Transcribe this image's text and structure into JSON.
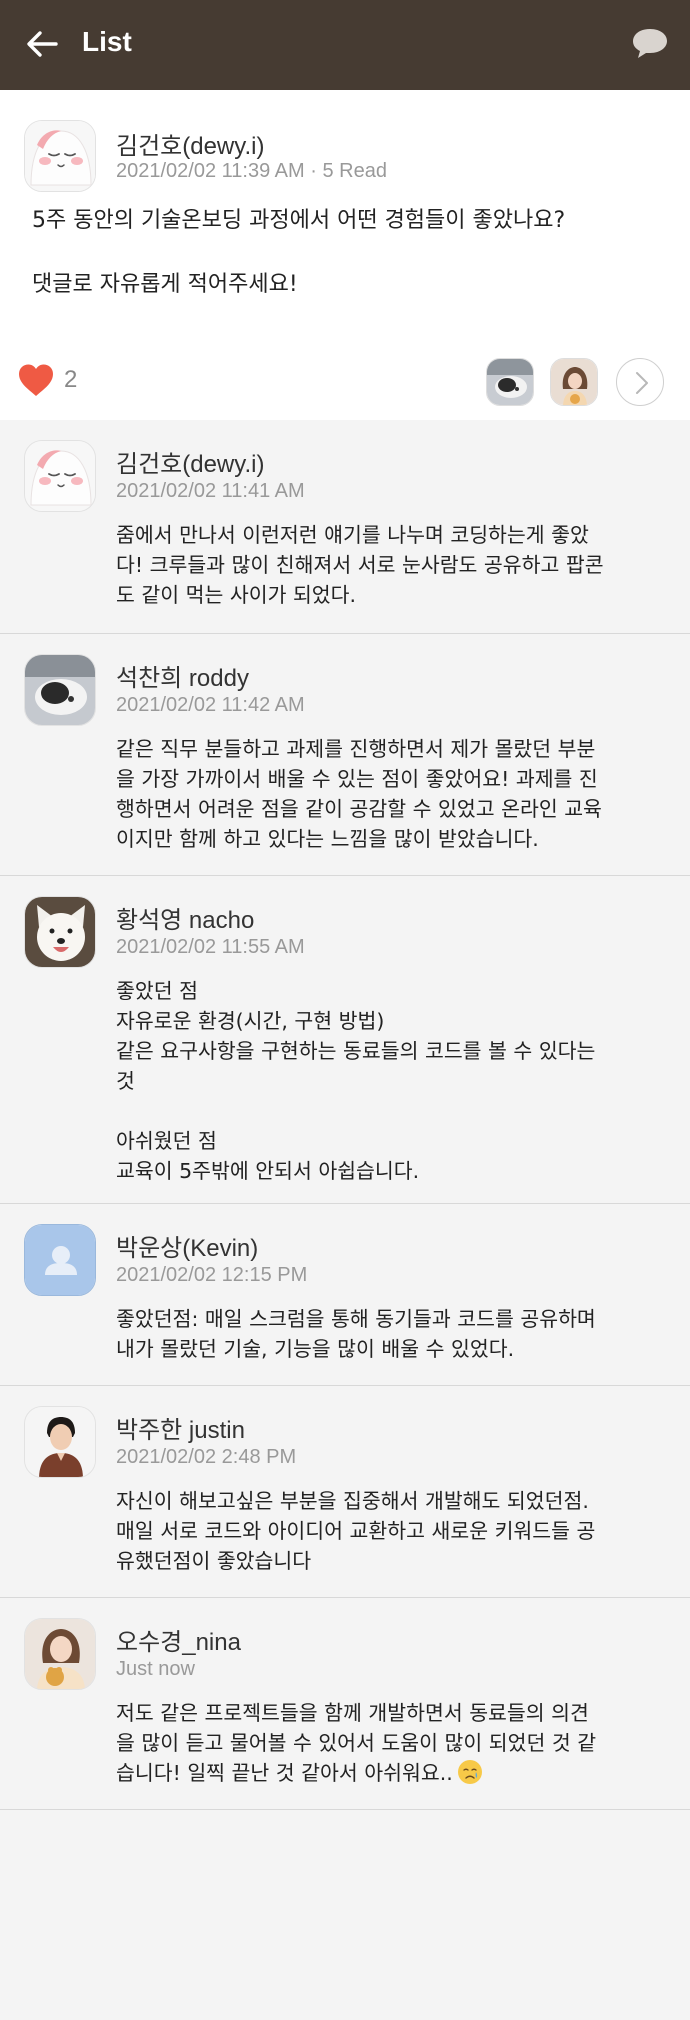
{
  "header": {
    "title": "List",
    "back_icon": "arrow-left-icon",
    "chat_icon": "chat-bubble-icon"
  },
  "post": {
    "author": "김건호(dewy.i)",
    "meta": "2021/02/02 11:39 AM · 5 Read",
    "line1": "5주 동안의 기술온보딩 과정에서 어떤 경험들이 좋았나요?",
    "line2": "댓글로 자유롭게 적어주세요!",
    "likes": "2",
    "accent_color": "#ef5a44"
  },
  "comments": [
    {
      "author": "김건호(dewy.i)",
      "time": "2021/02/02 11:41 AM",
      "body": "줌에서 만나서 이런저런 얘기를 나누며 코딩하는게 좋았\n다! 크루들과 많이 친해져서 서로 눈사람도 공유하고 팝콘\n도 같이 먹는 사이가 되었다."
    },
    {
      "author": "석찬희 roddy",
      "time": "2021/02/02 11:42 AM",
      "body": "같은 직무 분들하고 과제를 진행하면서 제가 몰랐던 부분\n을 가장 가까이서 배울 수 있는 점이 좋았어요! 과제를 진\n행하면서 어려운 점을 같이 공감할 수 있었고 온라인 교육\n이지만 함께 하고 있다는 느낌을 많이 받았습니다."
    },
    {
      "author": "황석영 nacho",
      "time": "2021/02/02 11:55 AM",
      "body": "좋았던 점\n자유로운 환경(시간, 구현 방법)\n같은 요구사항을 구현하는 동료들의 코드를 볼 수 있다는\n것\n\n아쉬웠던 점\n교육이 5주밖에 안되서 아쉽습니다."
    },
    {
      "author": "박운상(Kevin)",
      "time": "2021/02/02 12:15 PM",
      "body": "좋았던점: 매일 스크럼을 통해 동기들과 코드를 공유하며\n내가 몰랐던 기술, 기능을 많이 배울 수 있었다."
    },
    {
      "author": "박주한 justin",
      "time": "2021/02/02 2:48 PM",
      "body": "자신이 해보고싶은 부분을 집중해서 개발해도 되었던점.\n매일 서로 코드와 아이디어 교환하고 새로운 키워드들 공\n유했던점이 좋았습니다"
    },
    {
      "author": "오수경_nina",
      "time": "Just now",
      "body": "저도 같은 프로젝트들을 함께 개발하면서 동료들의 의견\n을 많이 듣고 물어볼 수 있어서 도움이 많이 되었던 것 같\n습니다! 일찍 끝난 것 같아서 아쉬워요..",
      "emoji": "crying-face-icon"
    }
  ]
}
